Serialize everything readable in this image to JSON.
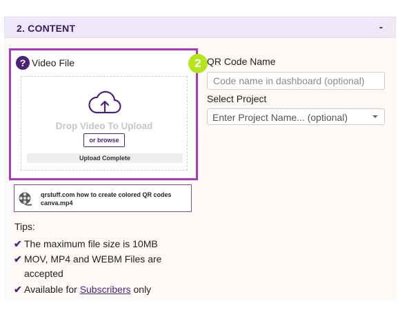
{
  "section": {
    "title": "2. CONTENT",
    "collapse_label": "-"
  },
  "video_file": {
    "help_icon": "question-circle-icon",
    "label": "Video File",
    "drop_text": "Drop Video To Upload",
    "browse_label": "or browse",
    "upload_status": "Upload Complete",
    "cloud_icon": "cloud-upload-icon"
  },
  "step_badge": "2",
  "uploaded_file": {
    "icon": "film-reel-icon",
    "name": "qrstuff.com how to create colored QR codes canva.mp4"
  },
  "qr_code_name": {
    "label": "QR Code Name",
    "value": "",
    "placeholder": "Code name in dashboard (optional)"
  },
  "project": {
    "label": "Select Project",
    "selected": "Enter Project Name... (optional)"
  },
  "tips": {
    "title": "Tips:",
    "items": [
      "The maximum file size is 10MB",
      "MOV, MP4 and WEBM Files are",
      "accepted"
    ],
    "subscribers_prefix": "Available for ",
    "subscribers_link": "Subscribers",
    "subscribers_suffix": " only"
  },
  "colors": {
    "accent": "#4b2477",
    "highlight": "#a83bb8",
    "badge": "#b5e61d",
    "header_bg": "#eee8f8"
  }
}
